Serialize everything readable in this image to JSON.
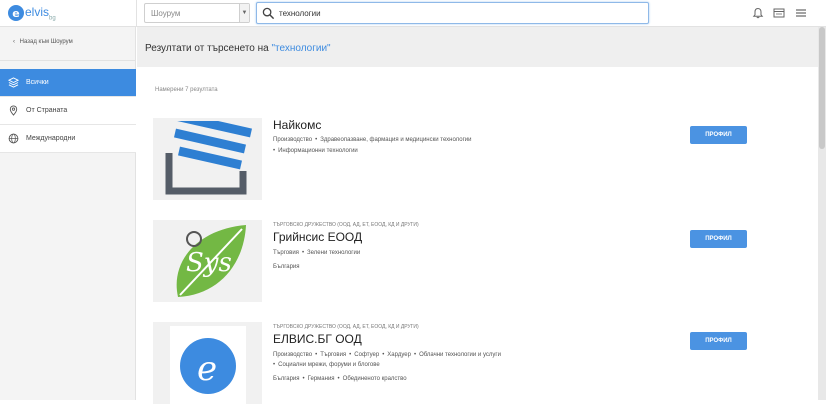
{
  "app": {
    "logo_letter": "e",
    "logo_name": "elvis",
    "logo_suffix": "bg"
  },
  "header": {
    "showroom_select": "Шоурум",
    "search_value": "технологии",
    "icons": [
      "bell-icon",
      "card-icon",
      "menu-icon"
    ]
  },
  "sidebar": {
    "back_label": "Назад към Шоурум",
    "items": [
      {
        "label": "Всички",
        "icon": "layers-icon",
        "active": true
      },
      {
        "label": "От Страната",
        "icon": "pin-icon",
        "active": false
      },
      {
        "label": "Международни",
        "icon": "globe-icon",
        "active": false
      }
    ]
  },
  "results": {
    "title_prefix": "Резултати от търсенето на",
    "query": "\"технологии\"",
    "count": "Намерени 7 резултата"
  },
  "companies": [
    {
      "type": "",
      "name": "Найкомс",
      "tags1": [
        "Производство",
        "Здравеопазване, фармация и медицински технологии"
      ],
      "tags2": [
        "Информационни технологии"
      ],
      "locations": [],
      "button": "ПРОФИЛ"
    },
    {
      "type": "ТЪРГОВСКО ДРУЖЕСТВО (ООД, АД, ЕТ, ЕООД, КД И ДРУГИ)",
      "name": "Грийнсис ЕООД",
      "tags1": [
        "Търговия",
        "Зелени технологии"
      ],
      "tags2": [],
      "locations": [
        "България"
      ],
      "button": "ПРОФИЛ"
    },
    {
      "type": "ТЪРГОВСКО ДРУЖЕСТВО (ООД, АД, ЕТ, ЕООД, КД И ДРУГИ)",
      "name": "ЕЛВИС.БГ ООД",
      "tags1": [
        "Производство",
        "Търговия",
        "Софтуер",
        "Хардуер",
        "Облачни технологии и услуги"
      ],
      "tags2": [
        "Социални мрежи, форуми и блогове"
      ],
      "locations": [
        "България",
        "Германия",
        "Обединеното кралство"
      ],
      "button": "ПРОФИЛ"
    }
  ],
  "colors": {
    "accent": "#3d8be0",
    "button": "#4b93e2"
  }
}
